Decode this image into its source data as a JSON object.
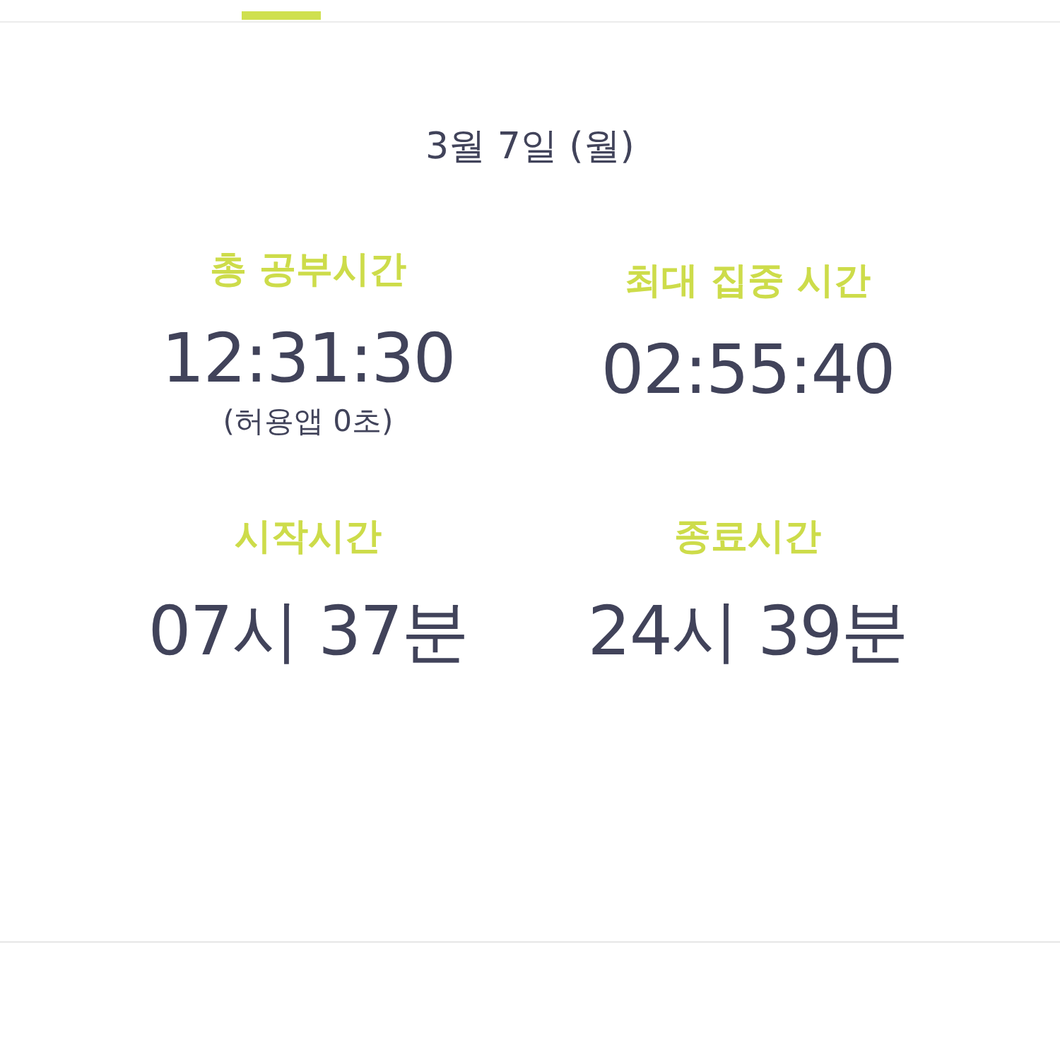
{
  "date": "3월 7일 (월)",
  "stats": [
    {
      "label": "총 공부시간",
      "value": "12:31:30",
      "note": "(허용앱  0초)"
    },
    {
      "label": "최대 집중 시간",
      "value": "02:55:40"
    },
    {
      "label": "시작시간",
      "value": "07시 37분"
    },
    {
      "label": "종료시간",
      "value": "24시 39분"
    }
  ]
}
